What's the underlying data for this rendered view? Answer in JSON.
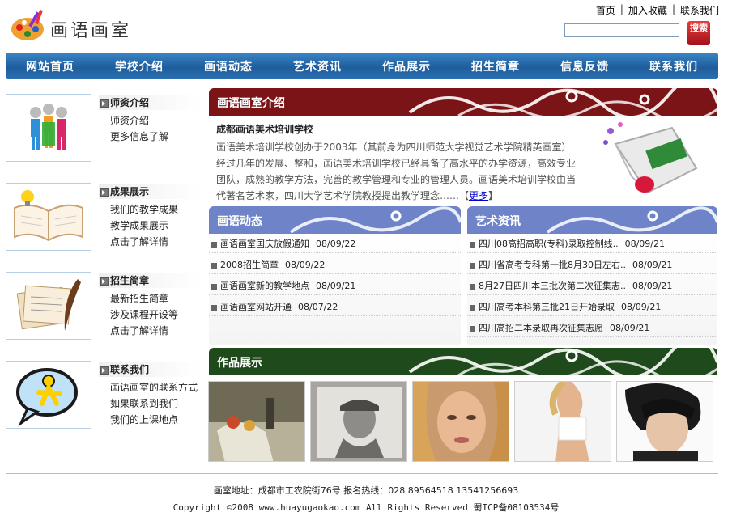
{
  "site": {
    "name": "画语画室"
  },
  "toplinks": [
    "首页",
    "加入收藏",
    "联系我们"
  ],
  "search": {
    "button_label": "搜索",
    "placeholder": ""
  },
  "nav": [
    "网站首页",
    "学校介绍",
    "画语动态",
    "艺术资讯",
    "作品展示",
    "招生简章",
    "信息反馈",
    "联系我们"
  ],
  "sidebar": [
    {
      "title": "师资介绍",
      "links": [
        "师资介绍",
        "更多信息了解"
      ],
      "icon": "people-icon"
    },
    {
      "title": "成果展示",
      "links": [
        "我们的教学成果",
        "教学成果展示",
        "点击了解详情"
      ],
      "icon": "book-icon"
    },
    {
      "title": "招生简章",
      "links": [
        "最新招生简章",
        "涉及课程开设等",
        "点击了解详情"
      ],
      "icon": "quill-paper-icon"
    },
    {
      "title": "联系我们",
      "links": [
        "画语画室的联系方式",
        "如果联系到我们",
        "我们的上课地点"
      ],
      "icon": "chat-icon"
    }
  ],
  "intro": {
    "title": "画语画室介绍",
    "subtitle": "成都画语美术培训学校",
    "body": "画语美术培训学校创办于2003年（其前身为四川师范大学视觉艺术学院精英画室）经过几年的发展、整和，画语美术培训学校已经具备了高水平的办学资源，高效专业团队，成熟的教学方法，完善的教学管理和专业的管理人员。画语美术培训学校由当代著名艺术家，四川大学艺术学院教授提出教学理念……",
    "more_open": "【",
    "more": "更多",
    "more_close": "】"
  },
  "news": {
    "title": "画语动态",
    "items": [
      {
        "text": "画语画室国庆放假通知",
        "date": "08/09/22"
      },
      {
        "text": "2008招生简章",
        "date": "08/09/22"
      },
      {
        "text": "画语画室新的教学地点",
        "date": "08/09/21"
      },
      {
        "text": "画语画室网站开通",
        "date": "08/07/22"
      }
    ]
  },
  "art": {
    "title": "艺术资讯",
    "items": [
      {
        "text": "四川08高招高职(专科)录取控制线..",
        "date": "08/09/21"
      },
      {
        "text": "四川省高考专科第一批8月30日左右..",
        "date": "08/09/21"
      },
      {
        "text": "8月27日四川本三批次第二次征集志..",
        "date": "08/09/21"
      },
      {
        "text": "四川高考本科第三批21日开始录取",
        "date": "08/09/21"
      },
      {
        "text": "四川高招二本录取再次征集志愿",
        "date": "08/09/21"
      }
    ]
  },
  "works": {
    "title": "作品展示"
  },
  "footer": {
    "address": "画室地址：成都市工农院街76号 报名热线：028 89564518 13541256693",
    "copyright": "Copyright ©2008 www.huayugaokao.com All Rights Reserved 蜀ICP备08103534号"
  },
  "colors": {
    "nav": "#1f5d9c",
    "intro_head": "#7a1417",
    "news_head": "#6f84c8",
    "works_head": "#1f4a1b"
  }
}
